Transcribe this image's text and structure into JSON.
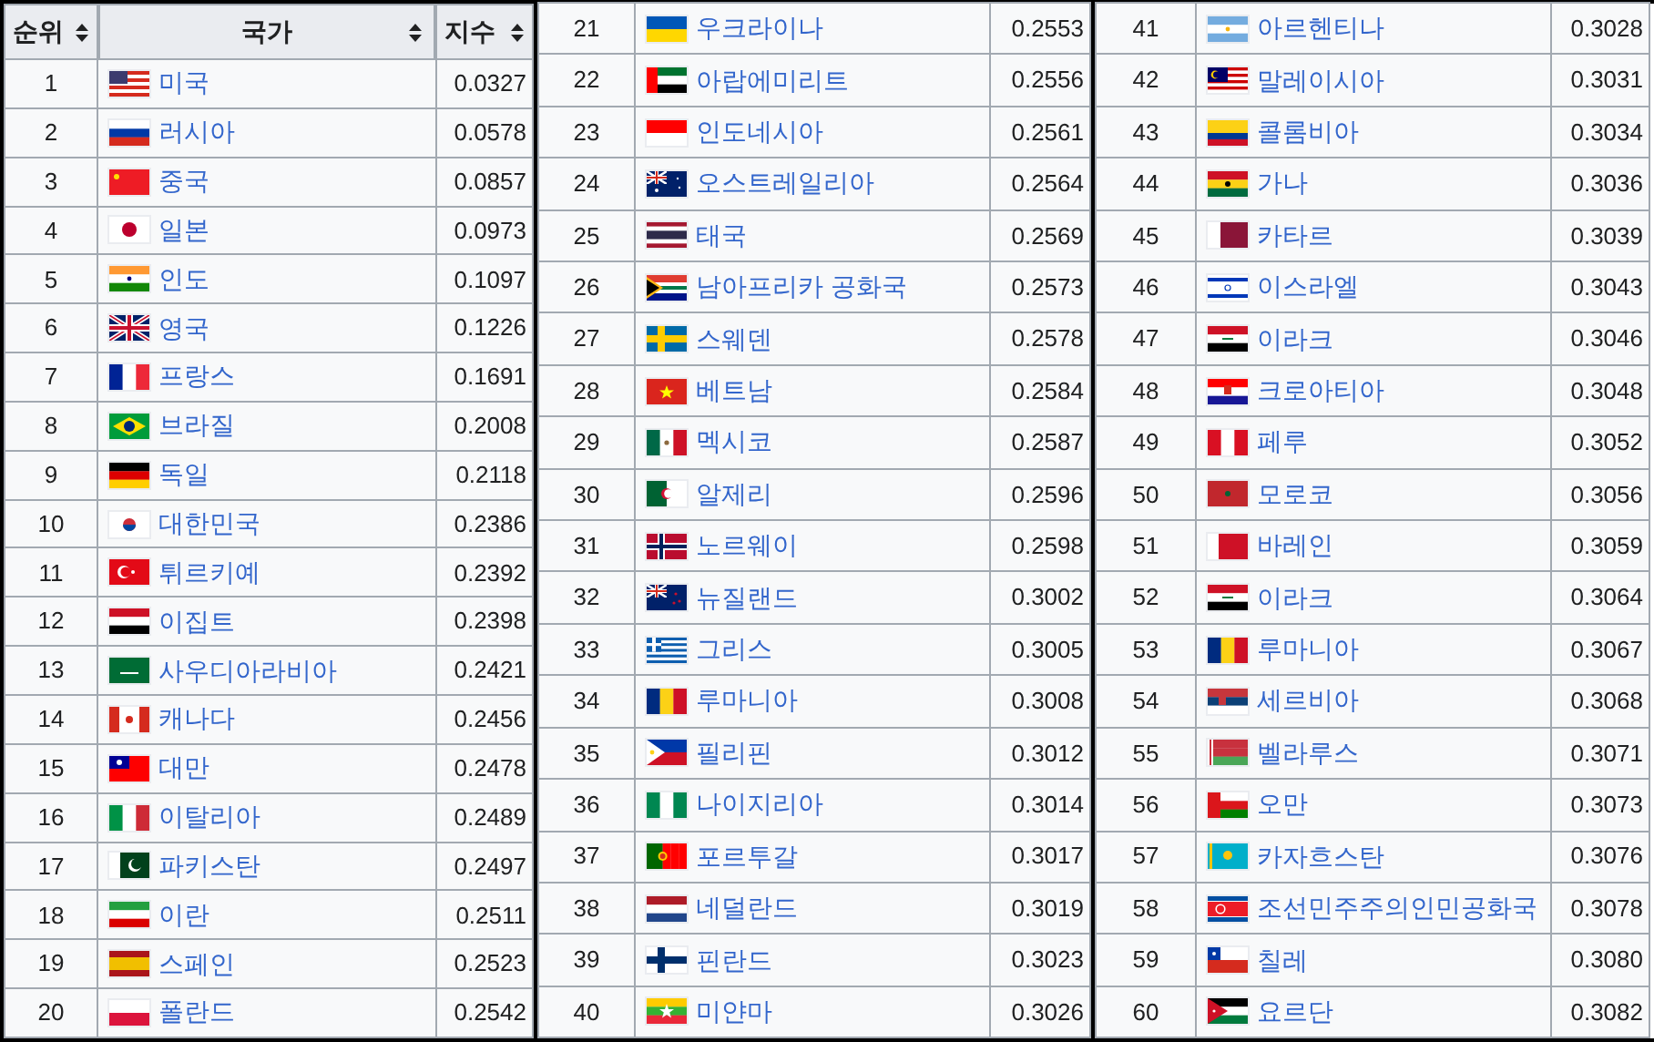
{
  "columns": [
    "순위",
    "국가",
    "지수"
  ],
  "tables": [
    {
      "rows": [
        {
          "rank": "1",
          "country": "미국",
          "index": "0.0327"
        },
        {
          "rank": "2",
          "country": "러시아",
          "index": "0.0578"
        },
        {
          "rank": "3",
          "country": "중국",
          "index": "0.0857"
        },
        {
          "rank": "4",
          "country": "일본",
          "index": "0.0973"
        },
        {
          "rank": "5",
          "country": "인도",
          "index": "0.1097"
        },
        {
          "rank": "6",
          "country": "영국",
          "index": "0.1226"
        },
        {
          "rank": "7",
          "country": "프랑스",
          "index": "0.1691"
        },
        {
          "rank": "8",
          "country": "브라질",
          "index": "0.2008"
        },
        {
          "rank": "9",
          "country": "독일",
          "index": "0.2118"
        },
        {
          "rank": "10",
          "country": "대한민국",
          "index": "0.2386"
        },
        {
          "rank": "11",
          "country": "튀르키예",
          "index": "0.2392"
        },
        {
          "rank": "12",
          "country": "이집트",
          "index": "0.2398"
        },
        {
          "rank": "13",
          "country": "사우디아라비아",
          "index": "0.2421"
        },
        {
          "rank": "14",
          "country": "캐나다",
          "index": "0.2456"
        },
        {
          "rank": "15",
          "country": "대만",
          "index": "0.2478"
        },
        {
          "rank": "16",
          "country": "이탈리아",
          "index": "0.2489"
        },
        {
          "rank": "17",
          "country": "파키스탄",
          "index": "0.2497"
        },
        {
          "rank": "18",
          "country": "이란",
          "index": "0.2511"
        },
        {
          "rank": "19",
          "country": "스페인",
          "index": "0.2523"
        },
        {
          "rank": "20",
          "country": "폴란드",
          "index": "0.2542"
        }
      ]
    },
    {
      "rows": [
        {
          "rank": "21",
          "country": "우크라이나",
          "index": "0.2553"
        },
        {
          "rank": "22",
          "country": "아랍에미리트",
          "index": "0.2556"
        },
        {
          "rank": "23",
          "country": "인도네시아",
          "index": "0.2561"
        },
        {
          "rank": "24",
          "country": "오스트레일리아",
          "index": "0.2564"
        },
        {
          "rank": "25",
          "country": "태국",
          "index": "0.2569"
        },
        {
          "rank": "26",
          "country": "남아프리카 공화국",
          "index": "0.2573"
        },
        {
          "rank": "27",
          "country": "스웨덴",
          "index": "0.2578"
        },
        {
          "rank": "28",
          "country": "베트남",
          "index": "0.2584"
        },
        {
          "rank": "29",
          "country": "멕시코",
          "index": "0.2587"
        },
        {
          "rank": "30",
          "country": "알제리",
          "index": "0.2596"
        },
        {
          "rank": "31",
          "country": "노르웨이",
          "index": "0.2598"
        },
        {
          "rank": "32",
          "country": "뉴질랜드",
          "index": "0.3002"
        },
        {
          "rank": "33",
          "country": "그리스",
          "index": "0.3005"
        },
        {
          "rank": "34",
          "country": "루마니아",
          "index": "0.3008"
        },
        {
          "rank": "35",
          "country": "필리핀",
          "index": "0.3012"
        },
        {
          "rank": "36",
          "country": "나이지리아",
          "index": "0.3014"
        },
        {
          "rank": "37",
          "country": "포르투갈",
          "index": "0.3017"
        },
        {
          "rank": "38",
          "country": "네덜란드",
          "index": "0.3019"
        },
        {
          "rank": "39",
          "country": "핀란드",
          "index": "0.3023"
        },
        {
          "rank": "40",
          "country": "미얀마",
          "index": "0.3026"
        }
      ]
    },
    {
      "rows": [
        {
          "rank": "41",
          "country": "아르헨티나",
          "index": "0.3028"
        },
        {
          "rank": "42",
          "country": "말레이시아",
          "index": "0.3031"
        },
        {
          "rank": "43",
          "country": "콜롬비아",
          "index": "0.3034"
        },
        {
          "rank": "44",
          "country": "가나",
          "index": "0.3036"
        },
        {
          "rank": "45",
          "country": "카타르",
          "index": "0.3039"
        },
        {
          "rank": "46",
          "country": "이스라엘",
          "index": "0.3043"
        },
        {
          "rank": "47",
          "country": "이라크",
          "index": "0.3046"
        },
        {
          "rank": "48",
          "country": "크로아티아",
          "index": "0.3048"
        },
        {
          "rank": "49",
          "country": "페루",
          "index": "0.3052"
        },
        {
          "rank": "50",
          "country": "모로코",
          "index": "0.3056"
        },
        {
          "rank": "51",
          "country": "바레인",
          "index": "0.3059"
        },
        {
          "rank": "52",
          "country": "이라크",
          "index": "0.3064"
        },
        {
          "rank": "53",
          "country": "루마니아",
          "index": "0.3067"
        },
        {
          "rank": "54",
          "country": "세르비아",
          "index": "0.3068"
        },
        {
          "rank": "55",
          "country": "벨라루스",
          "index": "0.3071"
        },
        {
          "rank": "56",
          "country": "오만",
          "index": "0.3073"
        },
        {
          "rank": "57",
          "country": "카자흐스탄",
          "index": "0.3076"
        },
        {
          "rank": "58",
          "country": "조선민주주의인민공화국",
          "index": "0.3078"
        },
        {
          "rank": "59",
          "country": "칠레",
          "index": "0.3080"
        },
        {
          "rank": "60",
          "country": "요르단",
          "index": "0.3082"
        }
      ]
    }
  ]
}
